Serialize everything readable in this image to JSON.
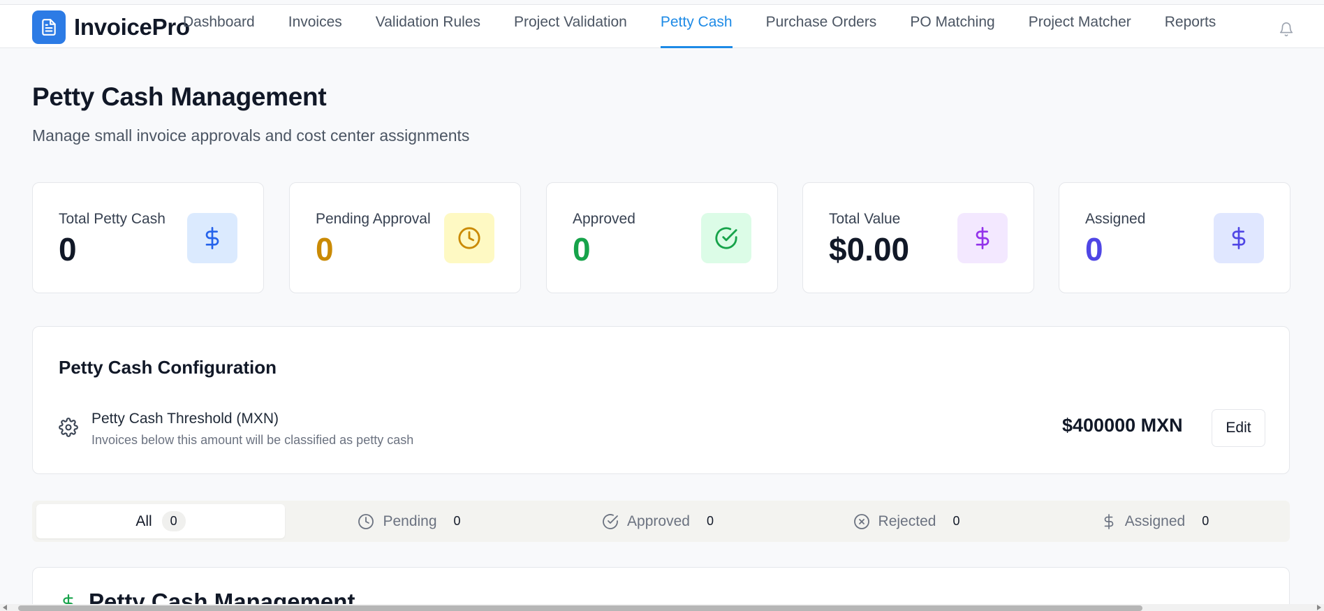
{
  "brand": {
    "name": "InvoicePro",
    "icon": "document-icon"
  },
  "nav": {
    "items": [
      {
        "label": "Dashboard"
      },
      {
        "label": "Invoices"
      },
      {
        "label": "Validation Rules"
      },
      {
        "label": "Project Validation"
      },
      {
        "label": "Petty Cash",
        "active": true
      },
      {
        "label": "Purchase Orders"
      },
      {
        "label": "PO Matching"
      },
      {
        "label": "Project Matcher"
      },
      {
        "label": "Reports"
      }
    ],
    "notification_icon": "bell-icon"
  },
  "header": {
    "title": "Petty Cash Management",
    "subtitle": "Manage small invoice approvals and cost center assignments"
  },
  "stats": [
    {
      "label": "Total Petty Cash",
      "value": "0",
      "value_color": "#111827",
      "icon": "dollar-icon",
      "icon_color": "#2563eb",
      "icon_bg": "#dbeafe"
    },
    {
      "label": "Pending Approval",
      "value": "0",
      "value_color": "#ca8a04",
      "icon": "clock-icon",
      "icon_color": "#ca8a04",
      "icon_bg": "#fef9c3"
    },
    {
      "label": "Approved",
      "value": "0",
      "value_color": "#16a34a",
      "icon": "check-circle-icon",
      "icon_color": "#16a34a",
      "icon_bg": "#dcfce7"
    },
    {
      "label": "Total Value",
      "value": "$0.00",
      "value_color": "#111827",
      "icon": "dollar-icon",
      "icon_color": "#9333ea",
      "icon_bg": "#f3e8ff"
    },
    {
      "label": "Assigned",
      "value": "0",
      "value_color": "#4f46e5",
      "icon": "dollar-icon",
      "icon_color": "#4f46e5",
      "icon_bg": "#e0e7ff"
    }
  ],
  "config": {
    "title": "Petty Cash Configuration",
    "threshold_label": "Petty Cash Threshold (MXN)",
    "threshold_description": "Invoices below this amount will be classified as petty cash",
    "threshold_value": "$400000 MXN",
    "edit_label": "Edit"
  },
  "tabs": [
    {
      "label": "All",
      "count": "0",
      "active": true
    },
    {
      "label": "Pending",
      "count": "0",
      "icon": "clock-icon"
    },
    {
      "label": "Approved",
      "count": "0",
      "icon": "check-circle-icon"
    },
    {
      "label": "Rejected",
      "count": "0",
      "icon": "x-circle-icon"
    },
    {
      "label": "Assigned",
      "count": "0",
      "icon": "dollar-icon"
    }
  ],
  "list_section": {
    "title": "Petty Cash Management",
    "icon": "dollar-icon",
    "icon_color": "#16a34a"
  }
}
